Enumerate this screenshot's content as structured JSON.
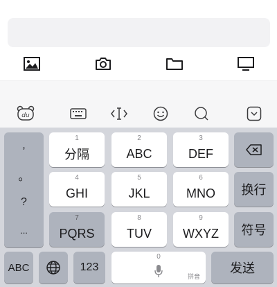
{
  "compose": {
    "input_value": "",
    "attachments": [
      {
        "icon": "image-icon"
      },
      {
        "icon": "camera-icon"
      },
      {
        "icon": "folder-icon"
      },
      {
        "icon": "monitor-icon"
      }
    ]
  },
  "toolbar": {
    "items": [
      {
        "icon": "bear-logo-icon"
      },
      {
        "icon": "keyboard-icon"
      },
      {
        "icon": "cursor-move-icon"
      },
      {
        "icon": "emoji-icon"
      },
      {
        "icon": "search-icon"
      },
      {
        "icon": "collapse-keyboard-icon"
      }
    ]
  },
  "keyboard": {
    "punctuation": [
      ",",
      "。",
      "?",
      "..."
    ],
    "keys": {
      "k1": {
        "num": "1",
        "label": "分隔"
      },
      "k2": {
        "num": "2",
        "label": "ABC"
      },
      "k3": {
        "num": "3",
        "label": "DEF"
      },
      "k4": {
        "num": "4",
        "label": "GHI"
      },
      "k5": {
        "num": "5",
        "label": "JKL"
      },
      "k6": {
        "num": "6",
        "label": "MNO"
      },
      "k7": {
        "num": "7",
        "label": "PQRS"
      },
      "k8": {
        "num": "8",
        "label": "TUV"
      },
      "k9": {
        "num": "9",
        "label": "WXYZ"
      }
    },
    "newline_label": "换行",
    "symbols_label": "符号",
    "abc_label": "ABC",
    "numbers_label": "123",
    "space": {
      "num": "0",
      "hint": "拼音"
    },
    "send_label": "发送",
    "colors": {
      "key": "#ffffff",
      "function_key": "#aeb3bd",
      "background": "#d4d6dc"
    }
  }
}
